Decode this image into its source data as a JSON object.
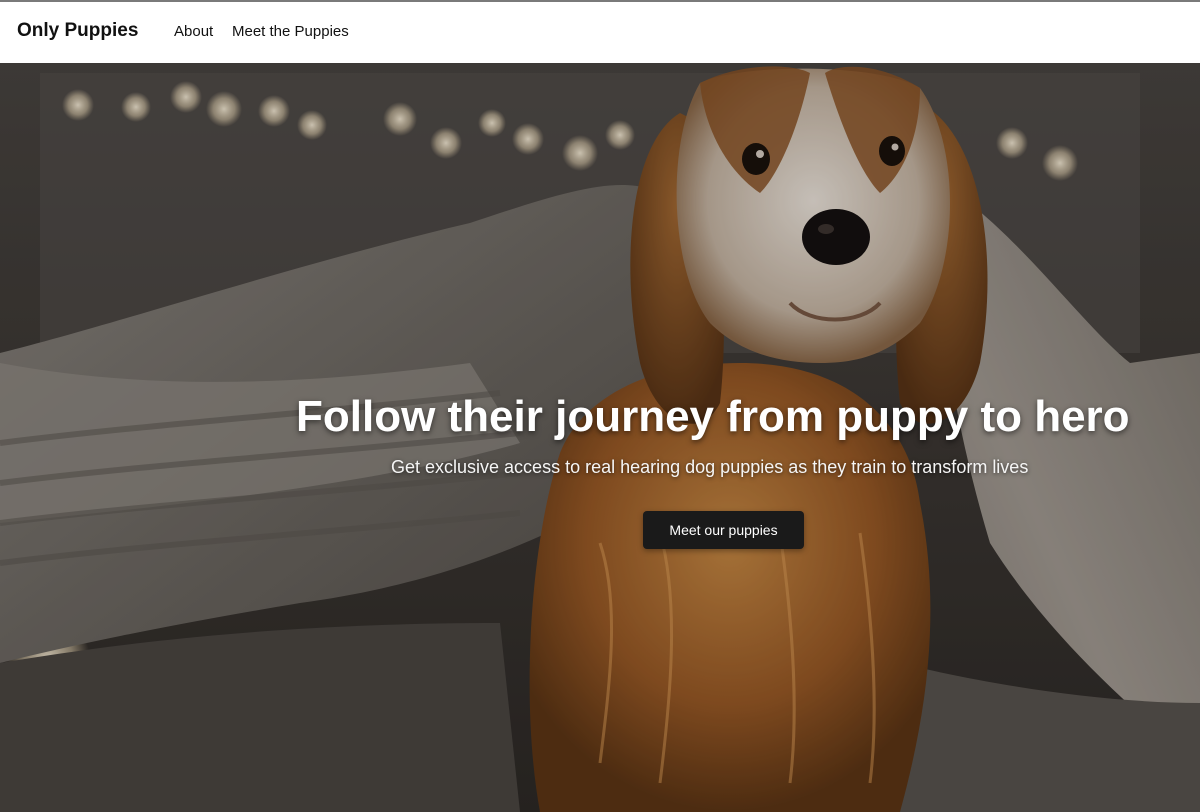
{
  "nav": {
    "brand": "Only Puppies",
    "links": [
      {
        "label": "About"
      },
      {
        "label": "Meet the Puppies"
      }
    ]
  },
  "hero": {
    "title": "Follow their journey from puppy to hero",
    "subtitle": "Get exclusive access to real hearing dog puppies as they train to transform lives",
    "cta_label": "Meet our puppies"
  },
  "colors": {
    "nav_background": "#ffffff",
    "cta_background": "#1a1a1a",
    "hero_text": "#ffffff"
  }
}
